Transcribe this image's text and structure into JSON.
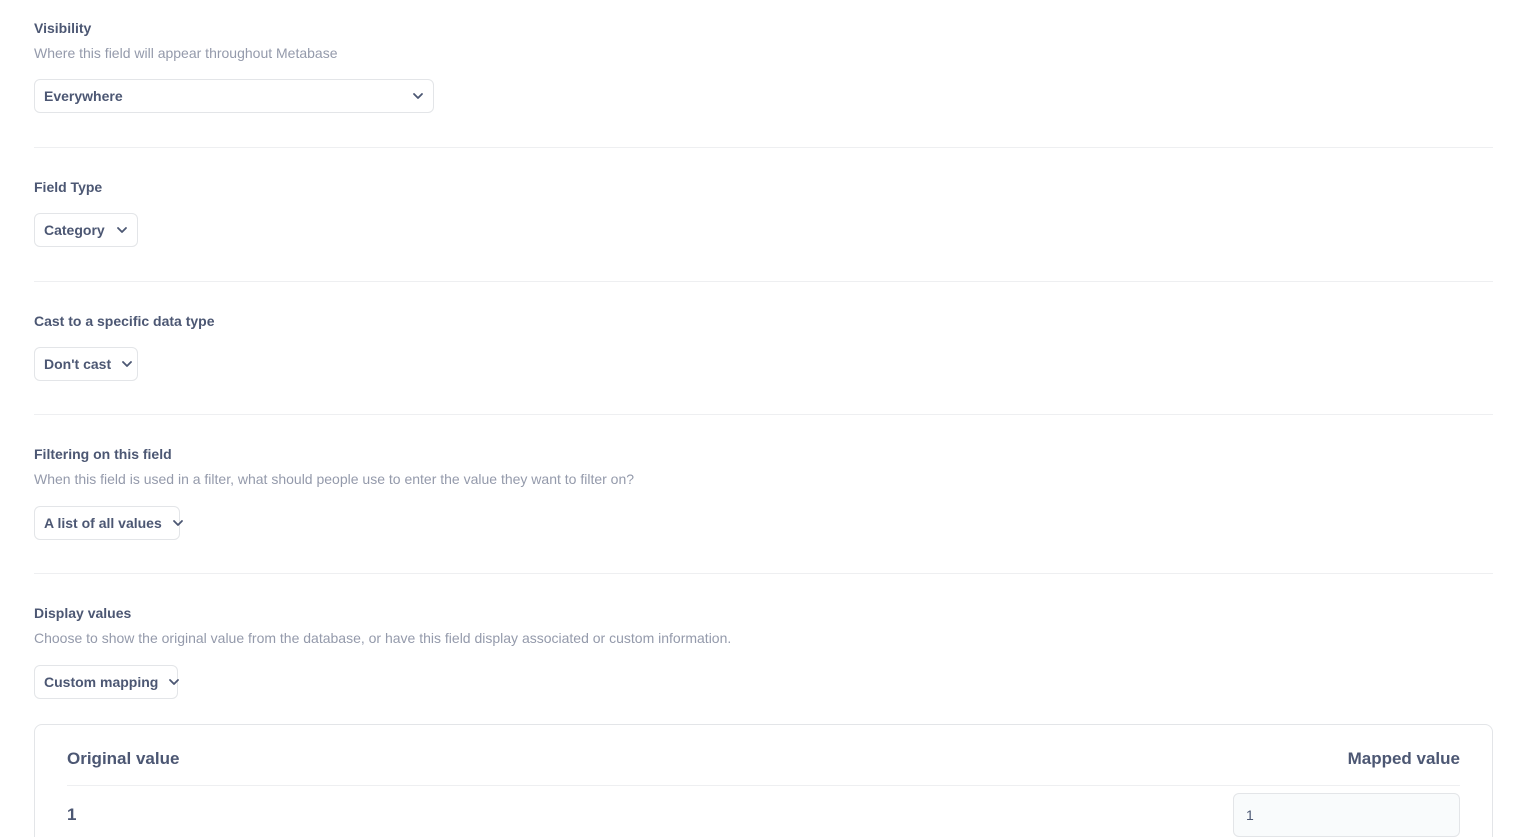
{
  "visibility": {
    "title": "Visibility",
    "description": "Where this field will appear throughout Metabase",
    "selected": "Everywhere"
  },
  "field_type": {
    "title": "Field Type",
    "selected": "Category"
  },
  "cast": {
    "title": "Cast to a specific data type",
    "selected": "Don't cast"
  },
  "filtering": {
    "title": "Filtering on this field",
    "description": "When this field is used in a filter, what should people use to enter the value they want to filter on?",
    "selected": "A list of all values"
  },
  "display_values": {
    "title": "Display values",
    "description": "Choose to show the original value from the database, or have this field display associated or custom information.",
    "selected": "Custom mapping"
  },
  "mapping": {
    "original_header": "Original value",
    "mapped_header": "Mapped value",
    "rows": [
      {
        "original": "1",
        "mapped": "1"
      }
    ]
  },
  "icons": {
    "dropdown": "chevron-down-icon"
  },
  "colors": {
    "text_primary": "#4c5773",
    "text_secondary": "#949aab",
    "border": "#e3e5e8"
  }
}
